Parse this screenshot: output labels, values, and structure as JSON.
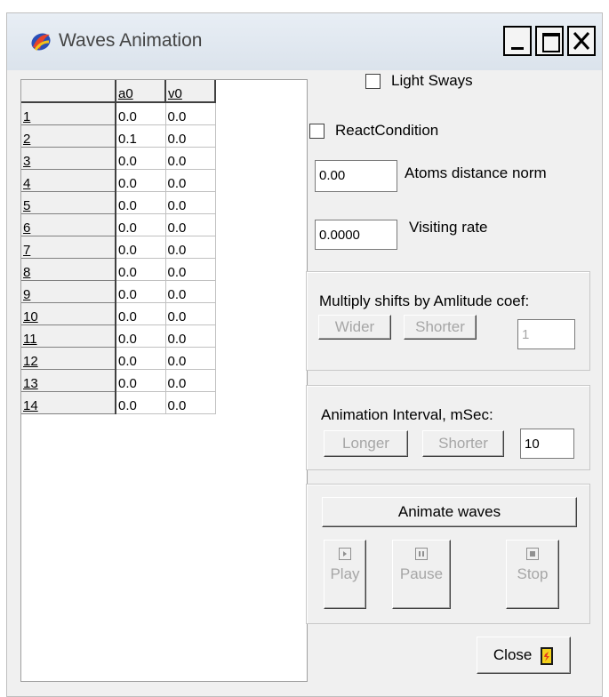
{
  "window": {
    "title": "Waves Animation",
    "icon": "app-swirl-icon"
  },
  "grid": {
    "columns": [
      "a0",
      "v0"
    ],
    "rows": [
      {
        "id": "1",
        "a0": "0.0",
        "v0": "0.0"
      },
      {
        "id": "2",
        "a0": "0.1",
        "v0": "0.0"
      },
      {
        "id": "3",
        "a0": "0.0",
        "v0": "0.0"
      },
      {
        "id": "4",
        "a0": "0.0",
        "v0": "0.0"
      },
      {
        "id": "5",
        "a0": "0.0",
        "v0": "0.0"
      },
      {
        "id": "6",
        "a0": "0.0",
        "v0": "0.0"
      },
      {
        "id": "7",
        "a0": "0.0",
        "v0": "0.0"
      },
      {
        "id": "8",
        "a0": "0.0",
        "v0": "0.0"
      },
      {
        "id": "9",
        "a0": "0.0",
        "v0": "0.0"
      },
      {
        "id": "10",
        "a0": "0.0",
        "v0": "0.0"
      },
      {
        "id": "11",
        "a0": "0.0",
        "v0": "0.0"
      },
      {
        "id": "12",
        "a0": "0.0",
        "v0": "0.0"
      },
      {
        "id": "13",
        "a0": "0.0",
        "v0": "0.0"
      },
      {
        "id": "14",
        "a0": "0.0",
        "v0": "0.0"
      }
    ]
  },
  "options": {
    "light_sways": "Light Sways",
    "react_condition": "ReactCondition"
  },
  "atoms_distance": {
    "value": "0.00",
    "label": "Atoms distance norm"
  },
  "visiting_rate": {
    "value": "0.0000",
    "label": "Visiting rate"
  },
  "amplitude": {
    "label": "Multiply shifts by Amlitude coef:",
    "wider": "Wider",
    "shorter": "Shorter",
    "value": "1"
  },
  "interval": {
    "label": "Animation Interval, mSec:",
    "longer": "Longer",
    "shorter": "Shorter",
    "value": "10"
  },
  "animate": {
    "label": "Animate waves",
    "play": "Play",
    "pause": "Pause",
    "stop": "Stop"
  },
  "close_label": "Close",
  "colors": {
    "titlebar": "#dbe3ec",
    "face": "#f0f0f0",
    "disabled_text": "#a6a6a6"
  }
}
